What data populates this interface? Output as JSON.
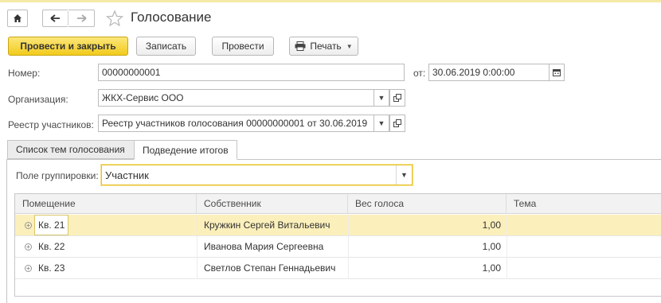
{
  "window": {
    "title": "Голосование"
  },
  "nav": {
    "home_icon": "home-icon",
    "back_icon": "arrow-left-icon",
    "forward_icon": "arrow-right-icon",
    "favorite_icon": "star-icon"
  },
  "toolbar": {
    "post_and_close_label": "Провести и закрыть",
    "save_label": "Записать",
    "post_label": "Провести",
    "print_label": "Печать"
  },
  "form": {
    "number_label": "Номер:",
    "number_value": "00000000001",
    "date_label": "от:",
    "date_value": "30.06.2019  0:00:00",
    "org_label": "Организация:",
    "org_value": "ЖКХ-Сервис ООО",
    "registry_label": "Реестр участников:",
    "registry_value": "Реестр участников голосования 00000000001 от 30.06.2019"
  },
  "tabs": [
    {
      "label": "Список тем голосования",
      "active": false
    },
    {
      "label": "Подведение итогов",
      "active": true
    }
  ],
  "grouping": {
    "label": "Поле группировки:",
    "value": "Участник"
  },
  "table": {
    "columns": [
      "Помещение",
      "Собственник",
      "Вес голоса",
      "Тема"
    ],
    "rows": [
      {
        "room": "Кв. 21",
        "owner": "Кружкин Сергей Витальевич",
        "weight": "1,00",
        "topic": ""
      },
      {
        "room": "Кв. 22",
        "owner": "Иванова Мария Сергеевна",
        "weight": "1,00",
        "topic": ""
      },
      {
        "room": "Кв. 23",
        "owner": "Светлов Степан Геннадьевич",
        "weight": "1,00",
        "topic": ""
      }
    ],
    "selected_row": 0
  },
  "colors": {
    "accent_yellow": "#f2cb1c",
    "selected_row": "#fbefbb"
  }
}
